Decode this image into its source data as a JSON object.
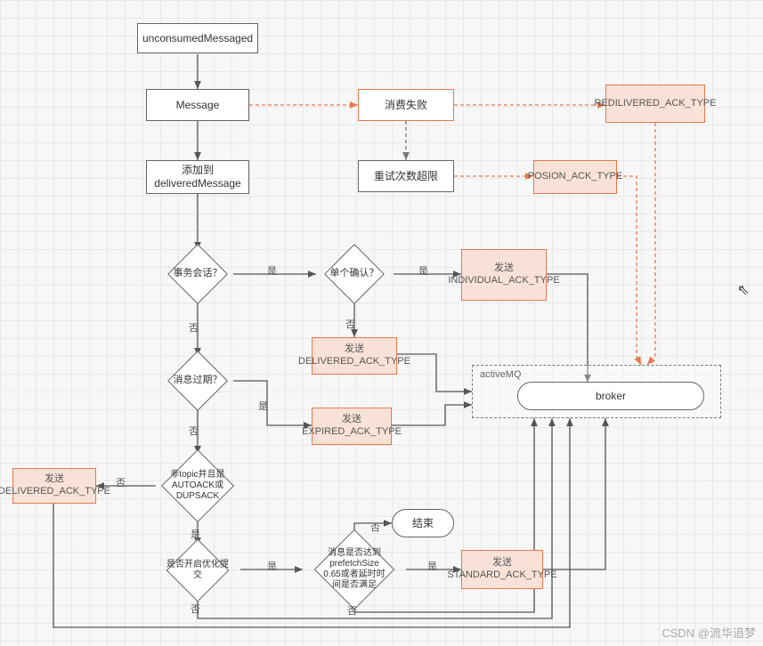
{
  "nodes": {
    "unconsumed": "unconsumedMessaged",
    "message": "Message",
    "consume_fail": "消费失败",
    "redelivered": "REDILIVERED_ACK_TYPE",
    "added": "添加到\ndeliveredMessage",
    "retry_exceeded": "重试次数超限",
    "posion": "POSION_ACK_TYPE",
    "transaction_session": "事务会话？",
    "individual_confirm": "单个确认？",
    "send_individual": "发送\nINDIVIDUAL_ACK_TYPE",
    "msg_expired": "消息过期？",
    "send_delivered": "发送\nDELIVERED_ACK_TYPE",
    "send_expired": "发送\nEXPIRED_ACK_TYPE",
    "topic_autoack": "非topic并且是\nAUTOACK或\nDUPSACK",
    "send_delivered2": "发送\nDELIVERED_ACK_TYPE",
    "optimize_commit": "是否开启优化提\n交",
    "prefetch_check": "消息是否达到\nprefetchSize\n0.65或者延时时\n间是否满足",
    "end": "结束",
    "send_standard": "发送\nSTANDARD_ACK_TYPE",
    "activemq_label": "activeMQ",
    "broker": "broker"
  },
  "edge_labels": {
    "yes": "是",
    "no": "否"
  },
  "cursor_glyph": "⇖",
  "watermark": "CSDN @流华追梦"
}
